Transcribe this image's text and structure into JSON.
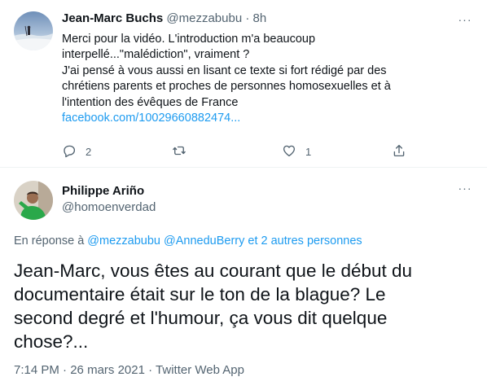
{
  "tweet1": {
    "author_name": "Jean-Marc Buchs",
    "author_handle": "@mezzabubu",
    "separator": "·",
    "time": "8h",
    "more_glyph": "···",
    "body_lines": [
      "Merci pour la vidéo. L'introduction m'a beaucoup",
      "interpellé...\"malédiction\", vraiment ?",
      "J'ai pensé à vous aussi en lisant ce texte si fort rédigé  par des",
      "chrétiens parents et proches de personnes homosexuelles et à",
      "l'intention des évêques de France"
    ],
    "link": "facebook.com/10029660882474...",
    "reply_count": "2",
    "retweet_count": "",
    "like_count": "1"
  },
  "tweet2": {
    "author_name": "Philippe Ariño",
    "author_handle": "@homoenverdad",
    "more_glyph": "···",
    "reply_prefix": "En réponse à",
    "mentions": [
      "@mezzabubu",
      "@AnneduBerry"
    ],
    "reply_suffix": "et 2 autres personnes",
    "body_lines": [
      "Jean-Marc, vous êtes au courant que le début du",
      "documentaire était sur le ton de la blague? Le",
      "second degré et l'humour, ça vous dit quelque",
      "chose?..."
    ],
    "time": "7:14 PM",
    "date": "26 mars 2021",
    "source": "Twitter Web App",
    "separator": "·"
  },
  "icons": {
    "reply": "speech-bubble-icon",
    "retweet": "retweet-icon",
    "like": "heart-icon",
    "share": "share-icon",
    "more": "more-dots-icon"
  },
  "colors": {
    "text": "#0f1419",
    "secondary": "#536471",
    "link": "#1d9bf0",
    "divider": "#eff3f4"
  }
}
